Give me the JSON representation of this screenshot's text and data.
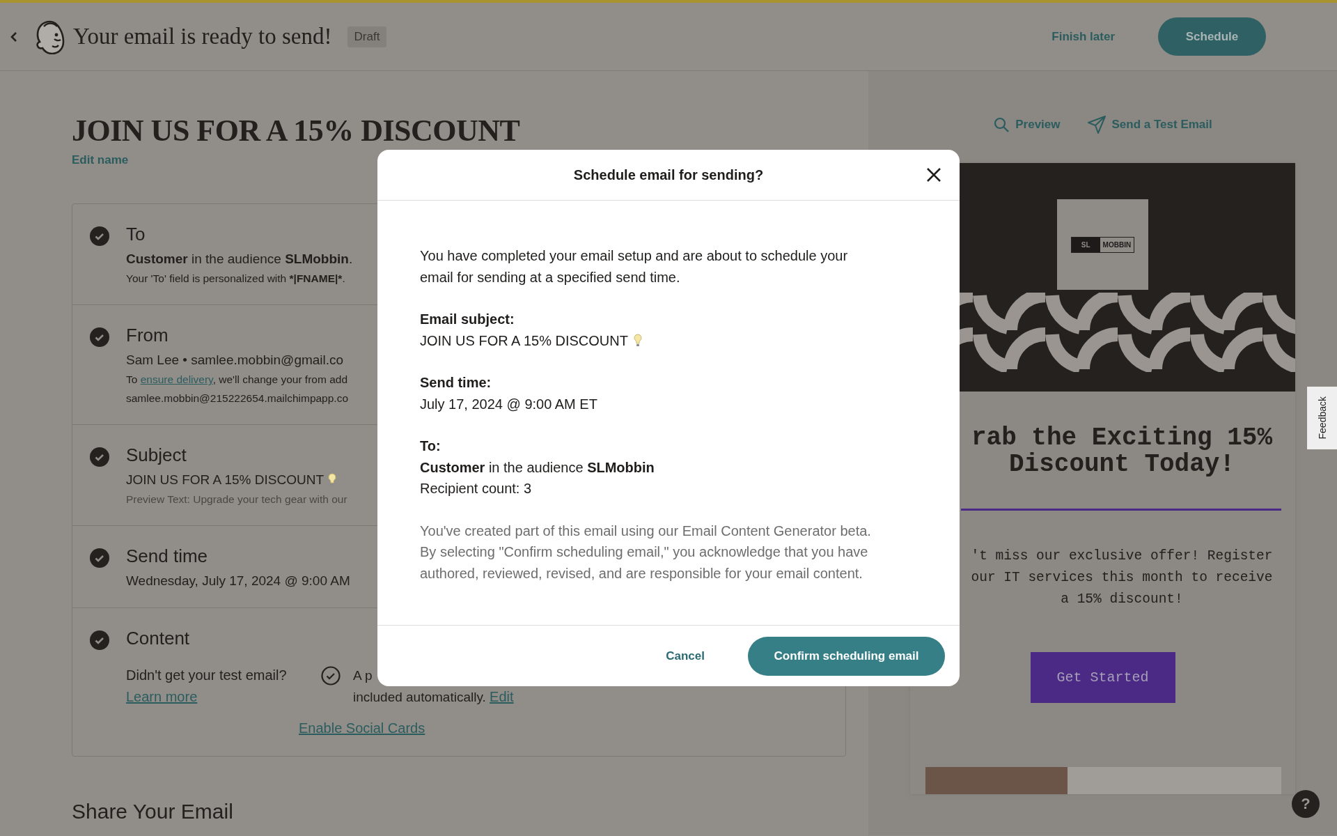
{
  "header": {
    "title": "Your email is ready to send!",
    "badge": "Draft",
    "finish_later": "Finish later",
    "schedule": "Schedule"
  },
  "campaign": {
    "name": "JOIN US FOR A 15% DISCOUNT",
    "edit_name": "Edit name"
  },
  "checklist": [
    {
      "kind": "summary",
      "title": "To",
      "complete": true,
      "lines": [
        {
          "kind": "main",
          "text": "**Customer** in the audience **SLMobbin**."
        },
        {
          "kind": "note",
          "text": "Your 'To' field is personalized with ",
          "strong": "*|FNAME|*",
          "after": "."
        }
      ]
    },
    {
      "kind": "summary",
      "title": "From",
      "complete": true,
      "lines": [
        {
          "kind": "main",
          "text": "Sam Lee • samlee.mobbin@gmail.co"
        },
        {
          "kind": "note",
          "text": "To ",
          "link": "ensure delivery",
          "after": ", we'll change your from add"
        },
        {
          "kind": "note",
          "text": "samlee.mobbin@215222654.mailchimpapp.co"
        }
      ]
    },
    {
      "kind": "summary",
      "title": "Subject",
      "complete": true,
      "lines": [
        {
          "kind": "subject",
          "text": "JOIN US FOR A 15% DISCOUNT"
        },
        {
          "kind": "muted",
          "text": "Preview Text: Upgrade your tech gear with our"
        }
      ]
    },
    {
      "kind": "summary",
      "title": "Send time",
      "complete": true,
      "lines": [
        {
          "kind": "main",
          "text": "Wednesday, July 17, 2024 @ 9:00 AM"
        }
      ]
    },
    {
      "kind": "content",
      "title": "Content",
      "complete": true,
      "test_email": "Didn't get your test email?",
      "learn_more": "Learn more",
      "plain_text_start": "A p",
      "plain_text_end": "included automatically.",
      "edit": "Edit",
      "social_cards": "Enable Social Cards"
    }
  ],
  "share_title": "Share Your Email",
  "preview": {
    "preview": "Preview",
    "send_test": "Send a Test Email",
    "logo_left": "SL",
    "logo_right": "MOBBIN",
    "headline": [
      "rab the Exciting 15%",
      "Discount Today!"
    ],
    "body": [
      "'t miss our exclusive offer! Register",
      "our IT services this month to receive",
      "a 15% discount!"
    ],
    "cta": "Get Started"
  },
  "modal": {
    "title": "Schedule email for sending?",
    "intro": "You have completed your email setup and are about to schedule your email for sending at a specified send time.",
    "sections": [
      {
        "label": "Email subject:",
        "lines": [
          {
            "kind": "subject",
            "text": "JOIN US FOR A 15% DISCOUNT"
          }
        ]
      },
      {
        "label": "Send time:",
        "lines": [
          {
            "text": "July 17, 2024 @ 9:00 AM ET"
          }
        ]
      },
      {
        "label": "To:",
        "lines": [
          {
            "text": "**Customer** in the audience **SLMobbin**"
          },
          {
            "text": "Recipient count: 3"
          }
        ]
      }
    ],
    "disclaimer": "You've created part of this email using our Email Content Generator beta. By selecting \"Confirm scheduling email,\" you acknowledge that you have authored, reviewed, revised, and are responsible for your email content.",
    "cancel": "Cancel",
    "confirm": "Confirm scheduling email"
  },
  "feedback": "Feedback",
  "help": "?"
}
